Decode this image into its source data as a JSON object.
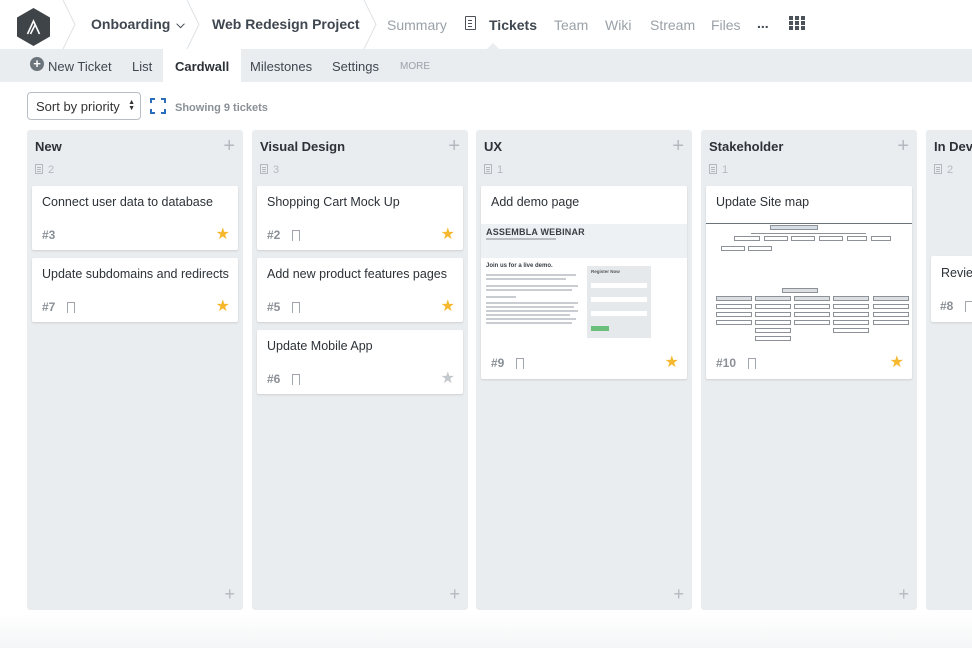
{
  "topnav": {
    "logo": "assembla-logo-icon",
    "breadcrumbs": [
      {
        "label": "Onboarding",
        "has_dropdown": true
      },
      {
        "label": "Web Redesign Project"
      }
    ],
    "links": [
      {
        "label": "Summary",
        "active": false
      },
      {
        "label": "Tickets",
        "active": true,
        "icon": "document-icon"
      },
      {
        "label": "Team",
        "active": false
      },
      {
        "label": "Wiki",
        "active": false
      },
      {
        "label": "Stream",
        "active": false
      },
      {
        "label": "Files",
        "active": false
      }
    ],
    "overflow_label": "...",
    "apps_icon": "grid-icon",
    "chevron": "⌄"
  },
  "subnav": {
    "new_ticket": "New Ticket",
    "items": [
      {
        "label": "List",
        "active": false
      },
      {
        "label": "Cardwall",
        "active": true
      },
      {
        "label": "Milestones",
        "active": false
      },
      {
        "label": "Settings",
        "active": false
      }
    ],
    "more": "MORE"
  },
  "toolbar": {
    "sort_value": "Sort by priority",
    "showing": "Showing 9 tickets"
  },
  "columns": [
    {
      "title": "New",
      "count": "2",
      "cards": [
        {
          "title": "Connect user data to database",
          "num": "#3",
          "bookmark": false,
          "starred": true
        },
        {
          "title": "Update subdomains and redirects",
          "num": "#7",
          "bookmark": true,
          "starred": true
        }
      ]
    },
    {
      "title": "Visual Design",
      "count": "3",
      "cards": [
        {
          "title": "Shopping Cart Mock Up",
          "num": "#2",
          "bookmark": true,
          "starred": true
        },
        {
          "title": "Add new product features pages",
          "num": "#5",
          "bookmark": true,
          "starred": true
        },
        {
          "title": "Update Mobile App",
          "num": "#6",
          "bookmark": true,
          "starred": false
        }
      ]
    },
    {
      "title": "UX",
      "count": "1",
      "cards": [
        {
          "title": "Add demo page",
          "num": "#9",
          "bookmark": true,
          "starred": true,
          "image": {
            "kind": "webinar",
            "heading": "ASSEMBLA WEBINAR",
            "subheading": "Join us for a live demo.",
            "form_title": "Register Now"
          }
        }
      ]
    },
    {
      "title": "Stakeholder",
      "count": "1",
      "cards": [
        {
          "title": "Update Site map",
          "num": "#10",
          "bookmark": true,
          "starred": true,
          "image": {
            "kind": "sitemap"
          }
        }
      ]
    },
    {
      "title": "In Dev",
      "count": "2",
      "cards": [
        {
          "title": "Review",
          "num": "#8",
          "bookmark": true,
          "starred": false
        }
      ]
    }
  ],
  "icons": {
    "add": "+",
    "star": "★",
    "sort_arrows": "▲▼"
  },
  "colors": {
    "star_on": "#f5b82e",
    "star_off": "#c3c8cd",
    "column_bg": "#e9edf0",
    "accent_blue": "#2a6ebb"
  }
}
